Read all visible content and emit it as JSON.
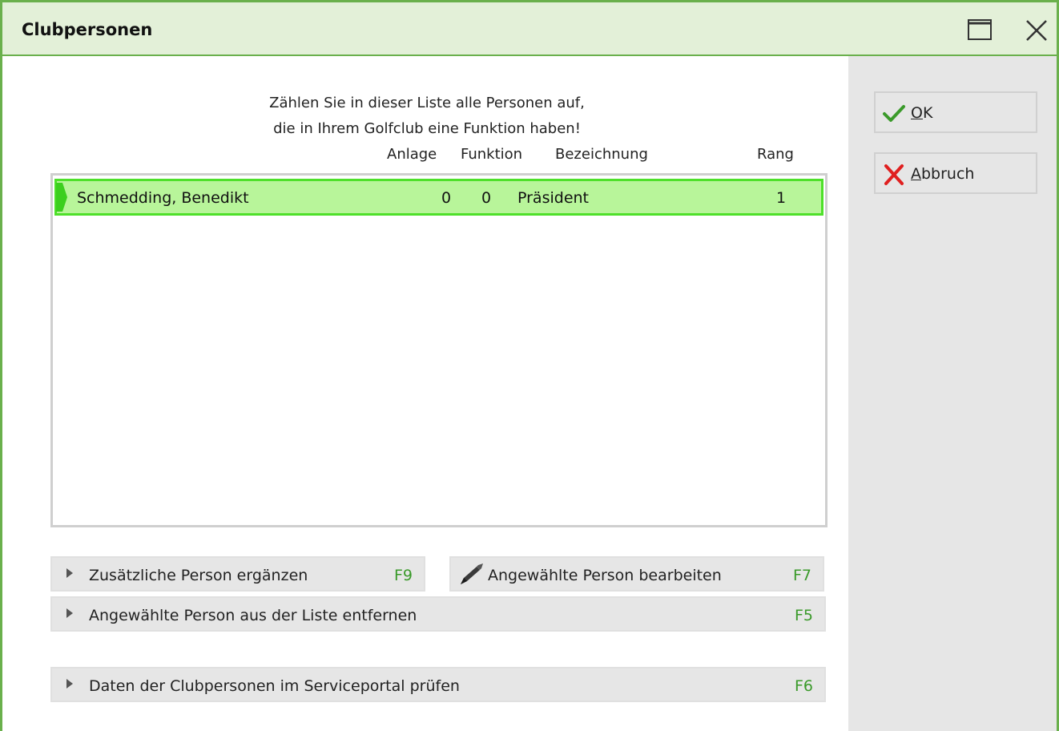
{
  "window": {
    "title": "Clubpersonen"
  },
  "intro": {
    "line1": "Zählen Sie in dieser Liste alle Personen auf,",
    "line2": "die in Ihrem Golfclub eine Funktion haben!"
  },
  "columns": {
    "anlage": "Anlage",
    "funktion": "Funktion",
    "bezeichnung": "Bezeichnung",
    "rang": "Rang"
  },
  "rows": [
    {
      "name": "Schmedding, Benedikt",
      "anlage": "0",
      "funktion": "0",
      "bezeichnung": "Präsident",
      "rang": "1",
      "selected": true
    }
  ],
  "actions": {
    "add": {
      "label": "Zusätzliche Person ergänzen",
      "key": "F9"
    },
    "edit": {
      "label": "Angewählte Person bearbeiten",
      "key": "F7"
    },
    "remove": {
      "label": "Angewählte Person aus der Liste entfernen",
      "key": "F5"
    },
    "check": {
      "label": "Daten der Clubpersonen im Serviceportal prüfen",
      "key": "F6"
    }
  },
  "side": {
    "ok": "OK",
    "cancel": "Abbruch"
  },
  "icons": {
    "maximize": "maximize-icon",
    "close": "close-icon",
    "ok": "checkmark-icon",
    "cancel": "x-icon",
    "edit": "pencil-icon",
    "expand": "triangle-right-icon",
    "row_marker": "row-indicator-icon"
  },
  "colors": {
    "accent_green": "#6ab04c",
    "title_bg": "#e3f0d8",
    "selection_bg": "#b8f59a",
    "selection_border": "#4ee02a",
    "hotkey_green": "#3a9a2a",
    "cancel_red": "#e02020"
  }
}
